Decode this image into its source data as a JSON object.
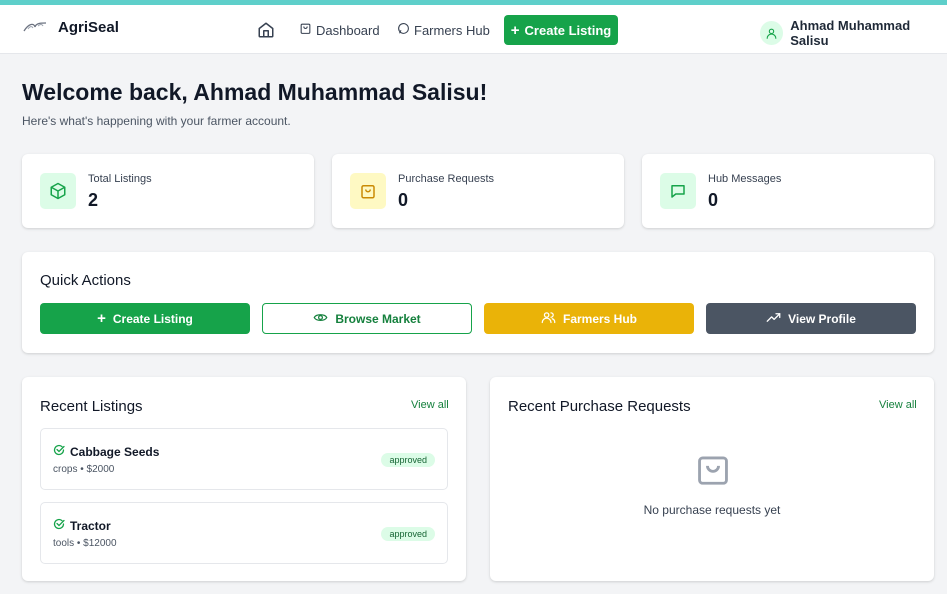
{
  "app": {
    "brand": "AgriSeal"
  },
  "nav": {
    "dashboard": "Dashboard",
    "farmers_hub": "Farmers Hub",
    "create_listing": "Create Listing"
  },
  "user": {
    "name": "Ahmad Muhammad Salisu"
  },
  "page": {
    "welcome": "Welcome back, Ahmad Muhammad Salisu!",
    "subtitle": "Here's what's happening with your farmer account."
  },
  "stats": [
    {
      "label": "Total Listings",
      "value": "2",
      "icon": "package-icon",
      "color": "#dcfce7"
    },
    {
      "label": "Purchase Requests",
      "value": "0",
      "icon": "shopping-bag-icon",
      "color": "#fef9c3"
    },
    {
      "label": "Hub Messages",
      "value": "0",
      "icon": "message-icon",
      "color": "#dcfce7"
    }
  ],
  "quick_actions": {
    "title": "Quick Actions",
    "buttons": [
      {
        "label": "Create Listing",
        "icon": "plus-icon",
        "color": "#16a34a"
      },
      {
        "label": "Browse Market",
        "icon": "eye-icon",
        "color": "#ffffff"
      },
      {
        "label": "Farmers Hub",
        "icon": "users-icon",
        "color": "#eab308"
      },
      {
        "label": "View Profile",
        "icon": "trending-up-icon",
        "color": "#4b5563"
      }
    ]
  },
  "recent_listings": {
    "title": "Recent Listings",
    "view_all": "View all",
    "items": [
      {
        "name": "Cabbage Seeds",
        "meta": "crops • $2000",
        "status": "approved"
      },
      {
        "name": "Tractor",
        "meta": "tools • $12000",
        "status": "approved"
      }
    ]
  },
  "recent_requests": {
    "title": "Recent Purchase Requests",
    "view_all": "View all",
    "empty_text": "No purchase requests yet"
  }
}
